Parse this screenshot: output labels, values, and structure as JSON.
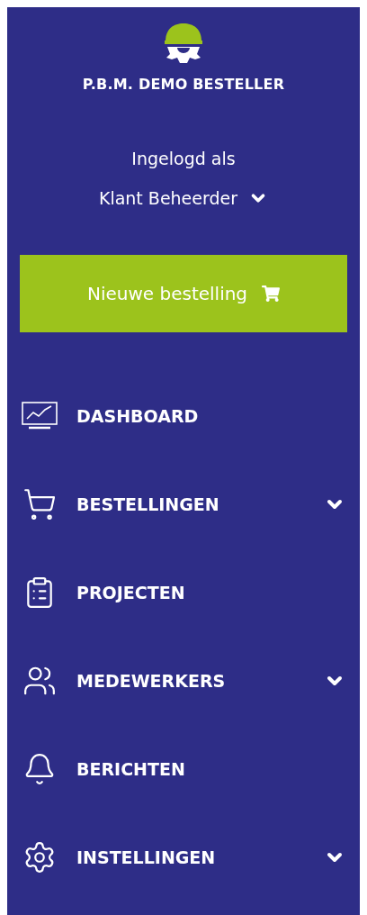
{
  "brand": {
    "title": "P.B.M. DEMO BESTELLER"
  },
  "user": {
    "caption": "Ingelogd als",
    "role": "Klant Beheerder"
  },
  "new_order_button": {
    "label": "Nieuwe bestelling"
  },
  "nav": [
    {
      "label": "DASHBOARD",
      "expandable": false
    },
    {
      "label": "BESTELLINGEN",
      "expandable": true
    },
    {
      "label": "PROJECTEN",
      "expandable": false
    },
    {
      "label": "MEDEWERKERS",
      "expandable": true
    },
    {
      "label": "BERICHTEN",
      "expandable": false
    },
    {
      "label": "INSTELLINGEN",
      "expandable": true
    }
  ]
}
